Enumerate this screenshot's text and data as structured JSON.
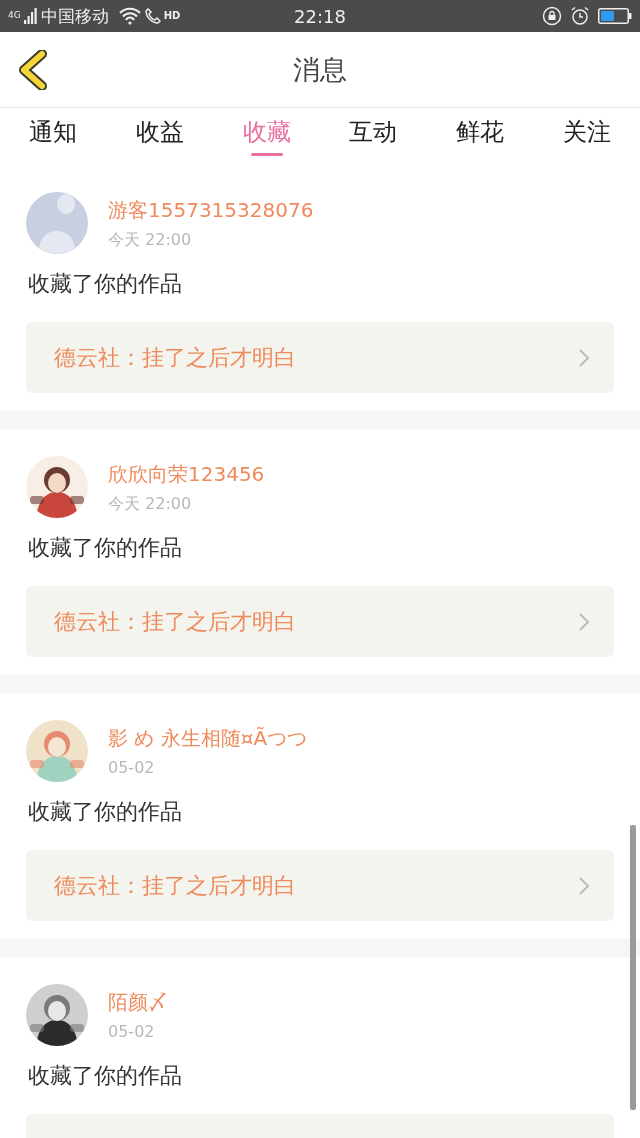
{
  "status_bar": {
    "network": "4G",
    "carrier": "中国移动",
    "call_badge": "HD",
    "time": "22:18"
  },
  "header": {
    "title": "消息"
  },
  "tabs": [
    {
      "label": "通知",
      "selected": false
    },
    {
      "label": "收益",
      "selected": false
    },
    {
      "label": "收藏",
      "selected": true
    },
    {
      "label": "互动",
      "selected": false
    },
    {
      "label": "鲜花",
      "selected": false
    },
    {
      "label": "关注",
      "selected": false
    }
  ],
  "messages": [
    {
      "avatar": {
        "kind": "default"
      },
      "user": "游客1557315328076",
      "time": "今天 22:00",
      "action": "收藏了你的作品",
      "work": "德云社：挂了之后才明白"
    },
    {
      "user": "欣欣向荣123456",
      "time": "今天 22:00",
      "action": "收藏了你的作品",
      "work": "德云社：挂了之后才明白"
    },
    {
      "user": "影 め 永生相随¤Ãつつ",
      "time": "05-02",
      "action": "收藏了你的作品",
      "work": "德云社：挂了之后才明白"
    },
    {
      "user": "陌颜〆",
      "time": "05-02",
      "action": "收藏了你的作品"
    }
  ]
}
